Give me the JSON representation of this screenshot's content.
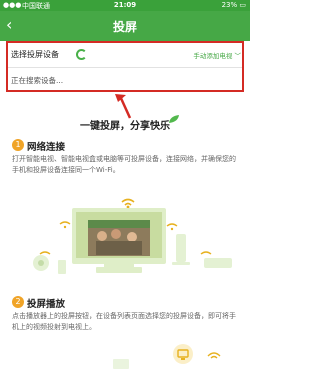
{
  "status_bar": {
    "carrier": "中国联通",
    "time": "21:09",
    "battery": "23%"
  },
  "nav": {
    "back_glyph": "‹",
    "title": "投屏"
  },
  "device_panel": {
    "select_label": "选择投屏设备",
    "manual_add_label": "手动添加电视 ",
    "searching_label": "正在搜索设备..."
  },
  "slogan": "一键投屏，分享快乐",
  "steps": [
    {
      "number": "1",
      "title": "网络连接",
      "description": "打开智能电视、智能电视盒或电脑等可投屏设备，连接网络，并确保您的手机和投屏设备连接同一个Wi-Fi。"
    },
    {
      "number": "2",
      "title": "投屏播放",
      "description": "点击播放器上的投屏按钮，在设备列表页面选择您的投屏设备，即可将手机上的视频投射到电视上。"
    }
  ],
  "colors": {
    "brand_green": "#46a846",
    "highlight_red": "#d42b24",
    "badge_orange": "#f0a428"
  }
}
